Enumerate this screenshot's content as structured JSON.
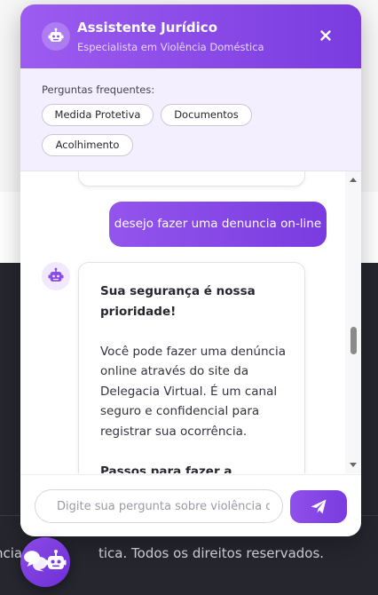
{
  "chat": {
    "title": "Assistente Jurídico",
    "subtitle": "Especialista em Violência Doméstica",
    "close_icon": "close-icon",
    "avatar_icon": "robot-icon"
  },
  "faq": {
    "label": "Perguntas frequentes:",
    "chips": [
      "Medida Protetiva",
      "Documentos",
      "Acolhimento"
    ]
  },
  "messages": {
    "user_message": "desejo fazer uma denuncia on-line",
    "bot_message": {
      "heading": "Sua segurança é nossa prioridade!",
      "paragraph": "Você pode fazer uma denúncia online através do site da Delegacia Virtual. É um canal seguro e confidencial para registrar sua ocorrência.",
      "next_heading": "Passos para fazer a denúncia"
    }
  },
  "composer": {
    "placeholder": "Digite sua pergunta sobre violência doméstica...",
    "value": "",
    "send_icon": "send-icon"
  },
  "footer": {
    "text_part1": "ncia",
    "text_part2": "tica. Todos os direitos reservados."
  },
  "launcher": {
    "icon": "chat-robot-icon"
  },
  "colors": {
    "accent": "#8a4be8",
    "accent_dark": "#7a3be0",
    "faq_background": "#f3efff",
    "footer_background": "#25262e"
  }
}
